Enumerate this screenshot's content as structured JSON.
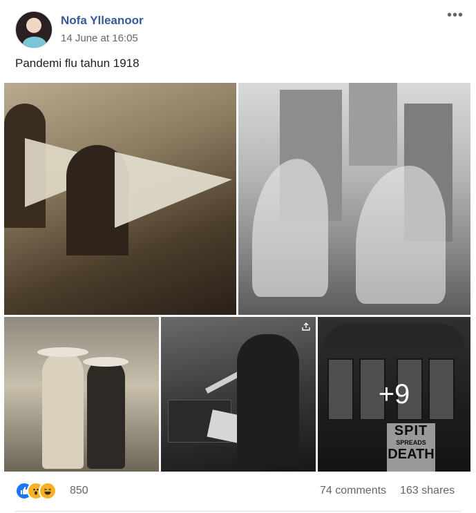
{
  "post": {
    "author": "Nofa Ylleanoor",
    "timestamp": "14 June at 16:05",
    "more_label": "•••",
    "text": "Pandemi flu tahun 1918"
  },
  "photos": {
    "more_count": "+9",
    "sign": {
      "line1": "SPIT",
      "line2": "SPREADS",
      "line3": "DEATH"
    }
  },
  "engagement": {
    "reactions": [
      "like-icon",
      "wow-icon",
      "haha-icon"
    ],
    "reaction_count": "850",
    "comments": "74 comments",
    "shares": "163 shares"
  },
  "colors": {
    "author_link": "#385898",
    "secondary_text": "#616770",
    "like_blue": "#1877f2",
    "reaction_yellow": "#f7b125"
  }
}
